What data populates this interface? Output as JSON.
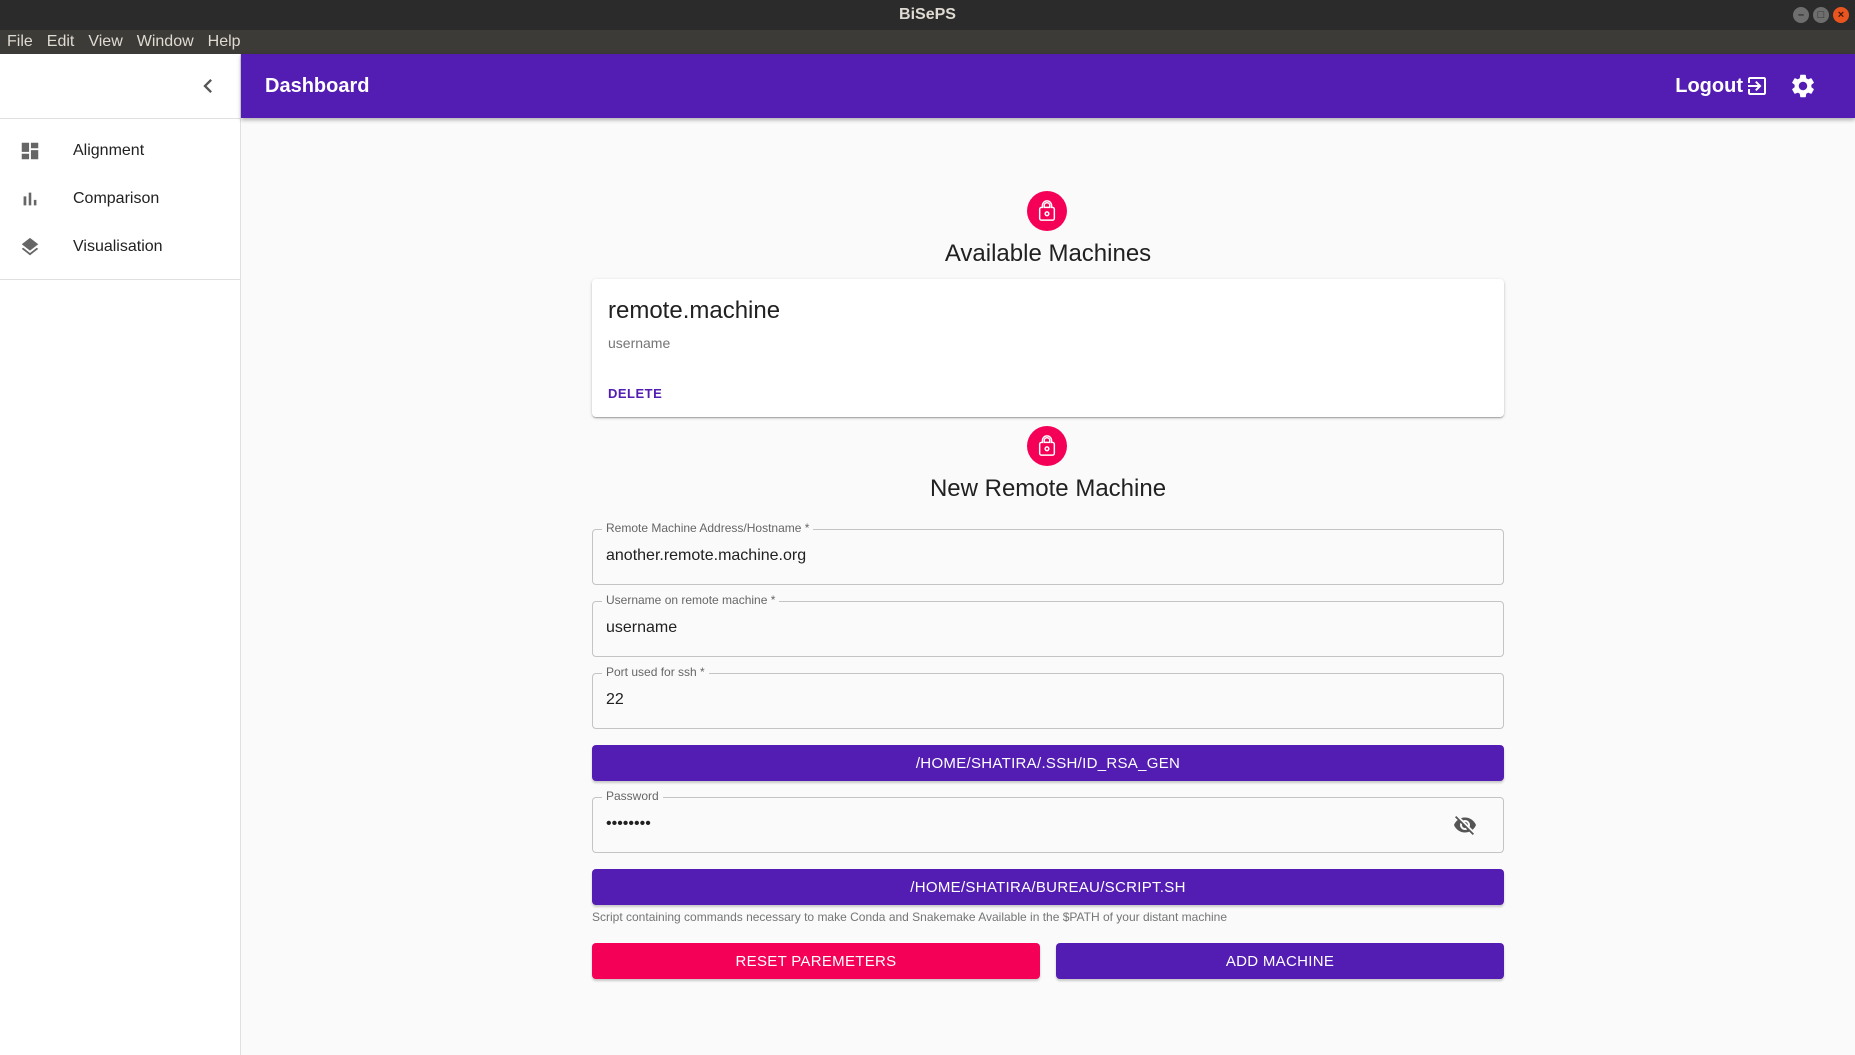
{
  "window": {
    "title": "BiSePS",
    "controls": {
      "minimize": "–",
      "maximize": "□",
      "close": "×"
    }
  },
  "menubar": {
    "items": [
      "File",
      "Edit",
      "View",
      "Window",
      "Help"
    ]
  },
  "sidebar": {
    "collapse_icon": "chevron-left-icon",
    "items": [
      {
        "label": "Alignment",
        "icon": "dashboard-icon"
      },
      {
        "label": "Comparison",
        "icon": "bar-chart-icon"
      },
      {
        "label": "Visualisation",
        "icon": "layers-icon"
      }
    ]
  },
  "appbar": {
    "title": "Dashboard",
    "logout_label": "Logout",
    "logout_icon": "exit-to-app-icon",
    "settings_icon": "gear-icon"
  },
  "available": {
    "title": "Available Machines",
    "icon": "lock-icon",
    "machines": [
      {
        "name": "remote.machine",
        "username": "username",
        "delete_label": "DELETE"
      }
    ]
  },
  "new_machine": {
    "title": "New Remote Machine",
    "icon": "lock-icon",
    "address": {
      "label": "Remote Machine Address/Hostname *",
      "value": "another.remote.machine.org"
    },
    "username": {
      "label": "Username on remote machine *",
      "value": "username"
    },
    "port": {
      "label": "Port used for ssh *",
      "value": "22"
    },
    "key_button": "/HOME/SHATIRA/.SSH/ID_RSA_GEN",
    "password": {
      "label": "Password",
      "value": "••••••••",
      "toggle_icon": "visibility-off-icon"
    },
    "script_button": "/HOME/SHATIRA/BUREAU/SCRIPT.SH",
    "script_helper": "Script containing commands necessary to make Conda and Snakemake Available in the $PATH of your distant machine",
    "reset_button": "RESET PAREMETERS",
    "add_button": "ADD MACHINE"
  },
  "colors": {
    "primary": "#531cb3",
    "secondary": "#f50057",
    "titlebar": "#2b2b2b",
    "menubar": "#3c3b37"
  }
}
